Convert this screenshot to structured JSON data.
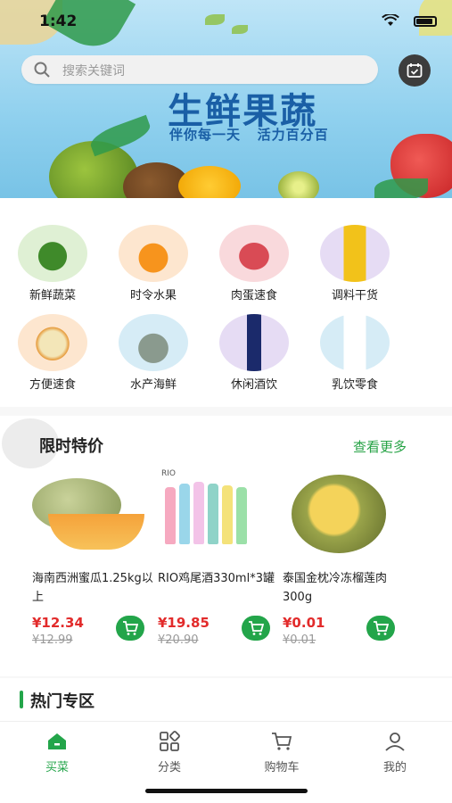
{
  "status": {
    "time": "1:42"
  },
  "search": {
    "placeholder": "搜索关键词"
  },
  "banner": {
    "title": "生鲜果蔬",
    "subtitle": "伴你每一天   活力百分百"
  },
  "categories": [
    {
      "label": "新鲜蔬菜",
      "color": "#dff0d4"
    },
    {
      "label": "时令水果",
      "color": "#fde6cf"
    },
    {
      "label": "肉蛋速食",
      "color": "#f9d9dc"
    },
    {
      "label": "调料干货",
      "color": "#e6dcf4"
    },
    {
      "label": "方便速食",
      "color": "#fde6cf"
    },
    {
      "label": "水产海鲜",
      "color": "#d6ecf6"
    },
    {
      "label": "休闲酒饮",
      "color": "#e6dcf4"
    },
    {
      "label": "乳饮零食",
      "color": "#d6ecf6"
    }
  ],
  "sale": {
    "title": "限时特价",
    "more": "查看更多",
    "products": [
      {
        "name": "海南西洲蜜瓜1.25kg以上",
        "price": "¥12.34",
        "old_price": "¥12.99"
      },
      {
        "name": "RIO鸡尾酒330ml*3罐",
        "price": "¥19.85",
        "old_price": "¥20.90",
        "brand": "RIO"
      },
      {
        "name": "泰国金枕冷冻榴莲肉300g",
        "price": "¥0.01",
        "old_price": "¥0.01"
      }
    ]
  },
  "hot": {
    "title": "热门专区"
  },
  "tabs": [
    {
      "label": "买菜",
      "icon": "home-icon",
      "active": true
    },
    {
      "label": "分类",
      "icon": "category-icon",
      "active": false
    },
    {
      "label": "购物车",
      "icon": "cart-icon",
      "active": false
    },
    {
      "label": "我的",
      "icon": "user-icon",
      "active": false
    }
  ],
  "colors": {
    "accent": "#23a54a",
    "price": "#e22b2b",
    "banner_text": "#1a5fa6"
  }
}
